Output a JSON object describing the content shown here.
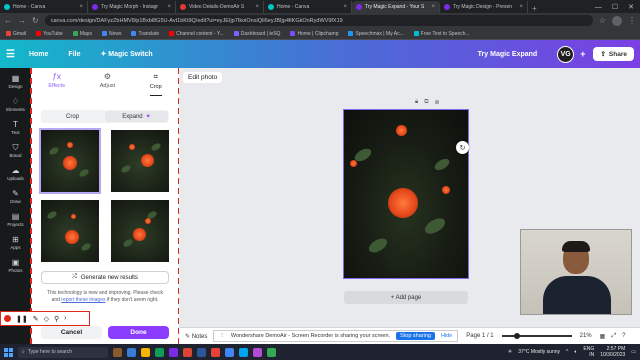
{
  "browser": {
    "tabs": [
      {
        "title": "Home - Canva",
        "color": "#00c4cc",
        "active": false
      },
      {
        "title": "Try Magic Morph - Instagr",
        "color": "#7d2ae8",
        "active": false
      },
      {
        "title": "Video Details-DemoAir S",
        "color": "#e53935",
        "active": false
      },
      {
        "title": "Home - Canva",
        "color": "#00c4cc",
        "active": false
      },
      {
        "title": "Try Magic Expand - Your S",
        "color": "#7d2ae8",
        "active": true
      },
      {
        "title": "Try Magic Design - Presen",
        "color": "#7d2ae8",
        "active": false
      }
    ],
    "url": "canva.com/design/DAFyzZbHMV8/p1Bxbl8G5U-Avt1bKt9Q/edit?ui=eyJEIjp7IkoiOnsiQiI6eyJBIjp4fiKGkOnRydWV9fX19",
    "bookmarks": [
      "Gmail",
      "YouTube",
      "Maps",
      "News",
      "Translate",
      "Channel content - Y...",
      "Dashboard | ieSQ",
      "Home | Clipchamp",
      "Speechmax | My Ac...",
      "Free Text to Speech..."
    ],
    "bookmark_colors": [
      "#ea4335",
      "#ff0000",
      "#34a853",
      "#4285f4",
      "#4285f4",
      "#ff0000",
      "#7b61ff",
      "#7c4dff",
      "#2196f3",
      "#00bcd4"
    ]
  },
  "header": {
    "home": "Home",
    "file": "File",
    "magic_switch": "Magic Switch",
    "try_label": "Try Magic Expand",
    "avatar_initials": "VG",
    "share": "Share"
  },
  "rail": {
    "items": [
      {
        "label": "Design",
        "glyph": "▦"
      },
      {
        "label": "Elements",
        "glyph": "♢"
      },
      {
        "label": "Text",
        "glyph": "T"
      },
      {
        "label": "Brand",
        "glyph": "⛉"
      },
      {
        "label": "Uploads",
        "glyph": "☁"
      },
      {
        "label": "Draw",
        "glyph": "✎"
      },
      {
        "label": "Projects",
        "glyph": "▤"
      },
      {
        "label": "Apps",
        "glyph": "⊞"
      },
      {
        "label": "Photos",
        "glyph": "▣"
      }
    ]
  },
  "panel": {
    "tabs": {
      "effects": "Effects",
      "adjust": "Adjust",
      "crop": "Crop"
    },
    "segment": {
      "crop": "Crop",
      "expand": "Expand"
    },
    "generate": "Generate new results",
    "note_pre": "This technology is new and improving. Please check and ",
    "note_link": "report these images",
    "note_post": " if they don't seem right.",
    "cancel": "Cancel",
    "done": "Done"
  },
  "canvas": {
    "edit_photo": "Edit photo",
    "add_page": "+ Add page"
  },
  "status": {
    "notes": "Notes",
    "sharing_msg": "Wondershare DemoAir - Screen Recorder is sharing your screen.",
    "stop_sharing": "Stop sharing",
    "hide": "Hide",
    "page": "Page 1 / 1",
    "zoom": "21%",
    "zoom_level": 0.21
  },
  "taskbar": {
    "search": "Type here to search",
    "weather": "37°C  Mostly sunny",
    "lang": "ENG",
    "region": "IN",
    "time": "2:57 PM",
    "date": "10/30/2023"
  }
}
